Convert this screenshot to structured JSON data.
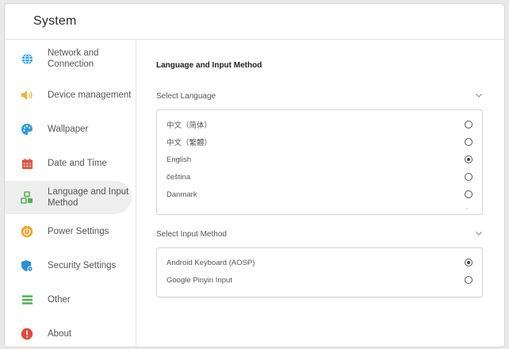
{
  "window": {
    "title": "System"
  },
  "sidebar": {
    "items": [
      {
        "label": "Network and Connection",
        "icon": "globe-icon",
        "color": "#29a3e0"
      },
      {
        "label": "Device management",
        "icon": "speaker-icon",
        "color": "#f2b233"
      },
      {
        "label": "Wallpaper",
        "icon": "palette-icon",
        "color": "#2d9bd8"
      },
      {
        "label": "Date and Time",
        "icon": "calendar-icon",
        "color": "#e0533f"
      },
      {
        "label": "Language and Input Method",
        "icon": "language-icon",
        "color": "#53b553",
        "active": true
      },
      {
        "label": "Power Settings",
        "icon": "power-icon",
        "color": "#f0a725"
      },
      {
        "label": "Security Settings",
        "icon": "shield-icon",
        "color": "#2c8fd3"
      },
      {
        "label": "Other",
        "icon": "list-icon",
        "color": "#4caf50"
      },
      {
        "label": "About",
        "icon": "info-icon",
        "color": "#e04a3a"
      }
    ]
  },
  "main": {
    "title": "Language and Input Method",
    "language": {
      "header": "Select Language",
      "options": [
        {
          "label": "中文（简体）",
          "checked": false
        },
        {
          "label": "中文（繁體）",
          "checked": false
        },
        {
          "label": "English",
          "checked": true
        },
        {
          "label": "čeština",
          "checked": false
        },
        {
          "label": "Danmark",
          "checked": false
        }
      ]
    },
    "input": {
      "header": "Select Input Method",
      "options": [
        {
          "label": "Android Keyboard (AOSP)",
          "checked": true
        },
        {
          "label": "Google Pinyin Input",
          "checked": false
        }
      ]
    }
  }
}
